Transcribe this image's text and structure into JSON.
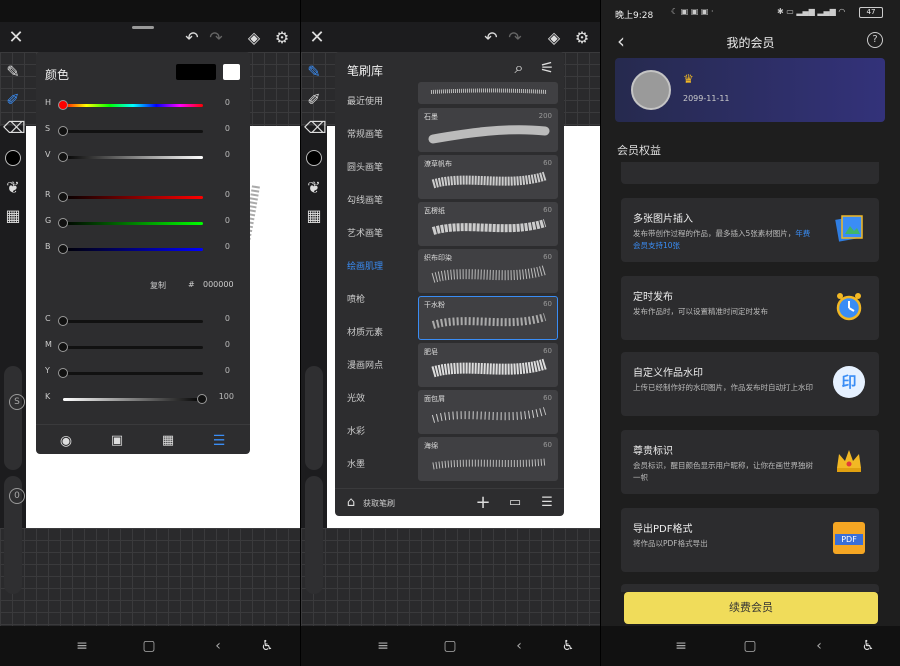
{
  "color_panel": {
    "title": "颜色",
    "primary_color": "#000000",
    "secondary_color": "#ffffff",
    "hsv": [
      {
        "label": "H",
        "value": "0"
      },
      {
        "label": "S",
        "value": "0"
      },
      {
        "label": "V",
        "value": "0"
      }
    ],
    "rgb": [
      {
        "label": "R",
        "value": "0"
      },
      {
        "label": "G",
        "value": "0"
      },
      {
        "label": "B",
        "value": "0"
      }
    ],
    "copy_label": "复制",
    "hex_prefix": "#",
    "hex_value": "000000",
    "cmyk": [
      {
        "label": "C",
        "value": "0"
      },
      {
        "label": "M",
        "value": "0"
      },
      {
        "label": "Y",
        "value": "0"
      },
      {
        "label": "K",
        "value": "100"
      }
    ]
  },
  "brush_library": {
    "title": "笔刷库",
    "categories": [
      "最近使用",
      "常规画笔",
      "圆头画笔",
      "勾线画笔",
      "艺术画笔",
      "绘画肌理",
      "喷枪",
      "材质元素",
      "漫画网点",
      "光效",
      "水彩",
      "水墨"
    ],
    "active_category": "绘画肌理",
    "brushes": [
      {
        "name": "",
        "size": ""
      },
      {
        "name": "石墨",
        "size": "200"
      },
      {
        "name": "潦草帆布",
        "size": "60"
      },
      {
        "name": "瓦楞纸",
        "size": "60"
      },
      {
        "name": "织布印染",
        "size": "60"
      },
      {
        "name": "干水粉",
        "size": "60"
      },
      {
        "name": "肥皂",
        "size": "60"
      },
      {
        "name": "面包屑",
        "size": "60"
      },
      {
        "name": "海绵",
        "size": "60"
      }
    ],
    "selected_brush": "干水粉",
    "get_brushes_label": "获取笔刷"
  },
  "tool_panel": {
    "s_label": "S",
    "o_label": "0"
  },
  "membership": {
    "status_time": "晚上9:28",
    "battery": "47",
    "title": "我的会员",
    "expiry": "2099-11-11",
    "section_title": "会员权益",
    "features": [
      {
        "title": "多张图片插入",
        "desc": "发布带创作过程的作品，最多插入5张素材图片，",
        "desc_highlight": "年费会员支持10张"
      },
      {
        "title": "定时发布",
        "desc": "发布作品时，可以设置精准时间定时发布",
        "desc_highlight": ""
      },
      {
        "title": "自定义作品水印",
        "desc": "上传已经制作好的水印图片，作品发布时自动打上水印",
        "desc_highlight": ""
      },
      {
        "title": "尊贵标识",
        "desc": "会员标识，醒目颜色显示用户昵称，让你在画世界独树一帜",
        "desc_highlight": ""
      },
      {
        "title": "导出PDF格式",
        "desc": "将作品以PDF格式导出",
        "desc_highlight": ""
      }
    ],
    "pdf_icon_text": "PDF",
    "watermark_icon_text": "印",
    "renew_label": "续费会员"
  },
  "colors": {
    "accent_blue": "#3a8df5",
    "renew_yellow": "#f0dc5a",
    "crown_gold": "#f2b824"
  }
}
